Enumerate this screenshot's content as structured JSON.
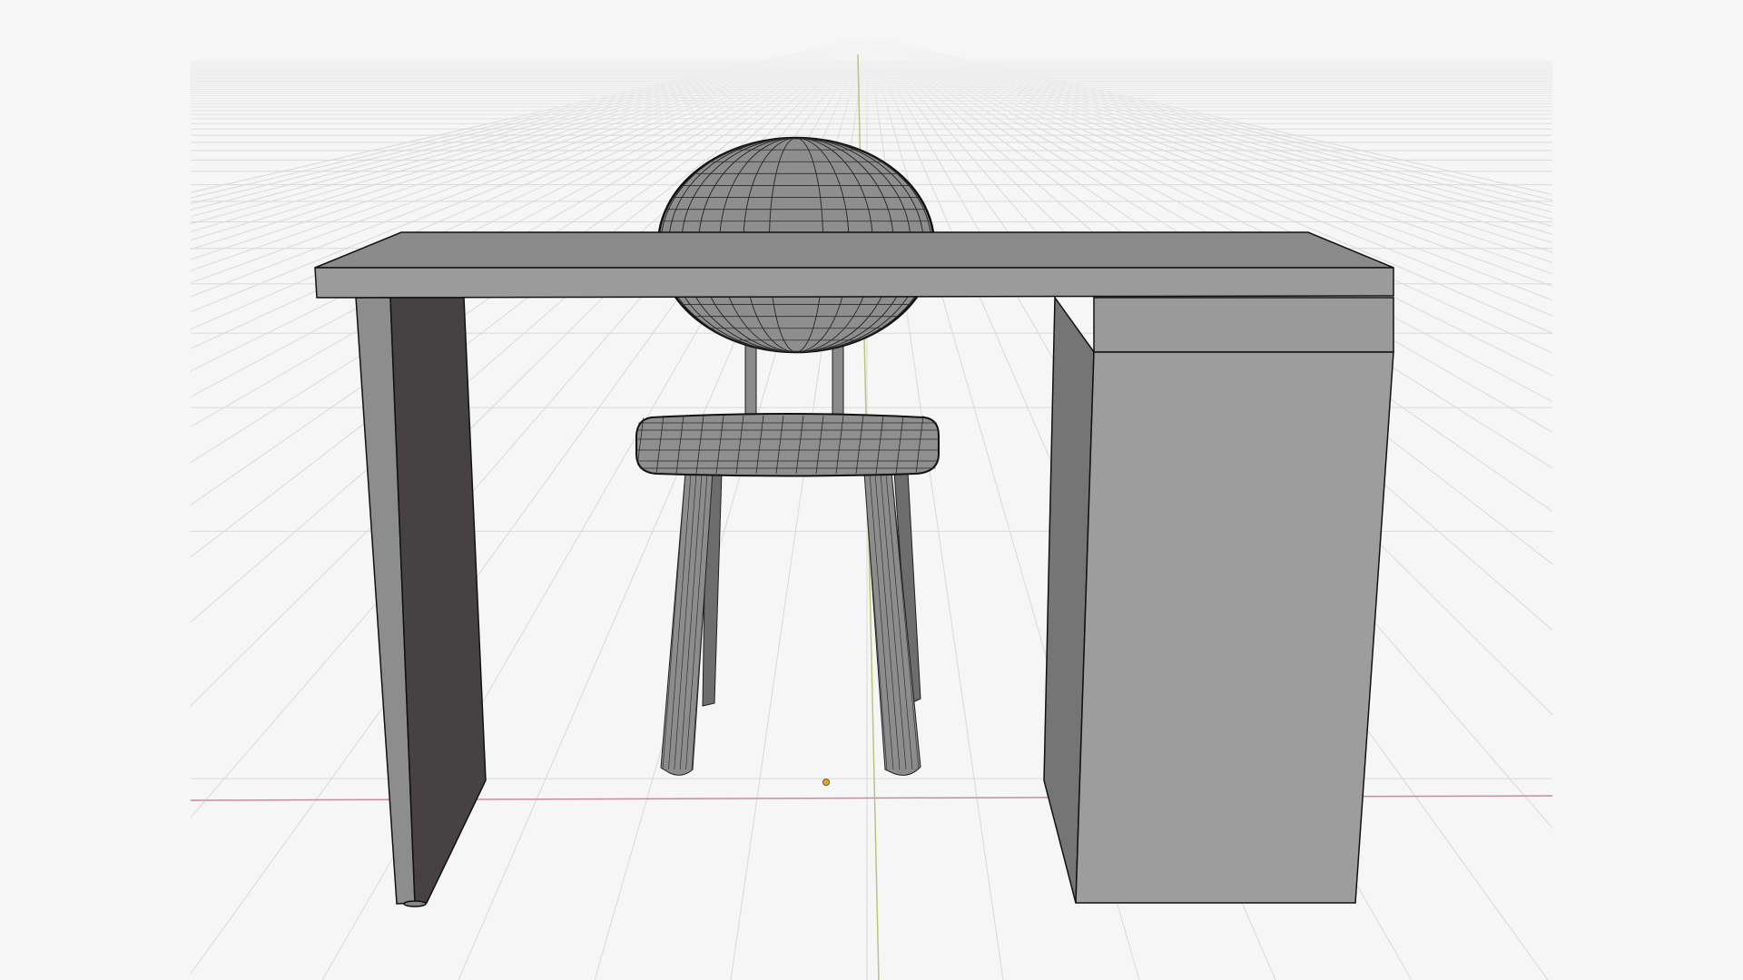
{
  "viewport": {
    "background_color": "#f6f6f6",
    "grid_color": "#d9d9d9",
    "x_axis_color": "#c98aa0",
    "y_axis_color": "#b7c77a",
    "origin_color": "#d9a33a"
  },
  "scene": {
    "objects": [
      {
        "name": "desk",
        "type": "mesh"
      },
      {
        "name": "chair",
        "type": "mesh"
      }
    ],
    "shading": "solid",
    "wireframe_overlay": true
  }
}
